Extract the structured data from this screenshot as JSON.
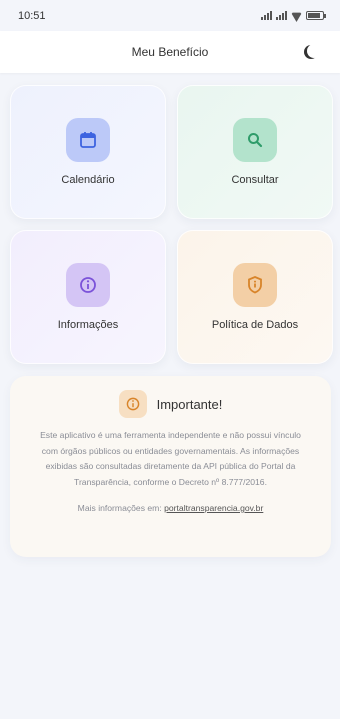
{
  "status": {
    "time": "10:51"
  },
  "header": {
    "title": "Meu Benefício",
    "theme_icon": "moon-icon"
  },
  "tiles": [
    {
      "label": "Calendário",
      "icon": "calendar-icon",
      "color": "#3d63e0"
    },
    {
      "label": "Consultar",
      "icon": "search-icon",
      "color": "#2f9c6a"
    },
    {
      "label": "Informações",
      "icon": "info-icon",
      "color": "#7b52d9"
    },
    {
      "label": "Política de Dados",
      "icon": "shield-icon",
      "color": "#d8842a"
    }
  ],
  "notice": {
    "title": "Importante!",
    "body": "Este aplicativo é uma ferramenta independente e não possui vínculo com órgãos públicos ou entidades governamentais. As informações exibidas são consultadas diretamente da API pública do Portal da Transparência, conforme o Decreto nº 8.777/2016.",
    "more_prefix": "Mais informações em:",
    "link": "portaltransparencia.gov.br"
  }
}
